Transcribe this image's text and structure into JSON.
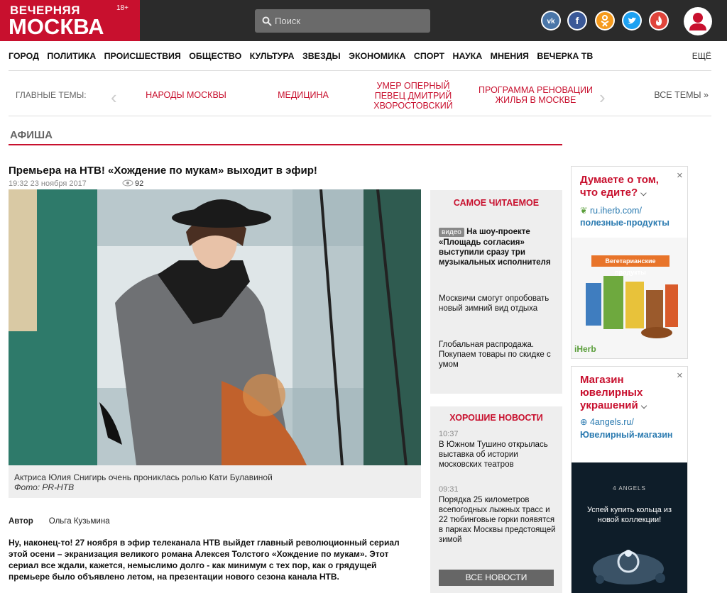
{
  "header": {
    "logo_line1": "ВЕЧЕРНЯЯ",
    "logo_line2": "МОСКВА",
    "age_rating": "18+",
    "search_placeholder": "Поиск"
  },
  "nav": {
    "items": [
      "ГОРОД",
      "ПОЛИТИКА",
      "ПРОИСШЕСТВИЯ",
      "ОБЩЕСТВО",
      "КУЛЬТУРА",
      "ЗВЕЗДЫ",
      "ЭКОНОМИКА",
      "СПОРТ",
      "НАУКА",
      "МНЕНИЯ",
      "ВЕЧЕРКА ТВ"
    ],
    "more": "ЕЩЁ"
  },
  "topics": {
    "label": "ГЛАВНЫЕ ТЕМЫ:",
    "items": [
      "НАРОДЫ МОСКВЫ",
      "МЕДИЦИНА",
      "УМЕР ОПЕРНЫЙ ПЕВЕЦ ДМИТРИЙ ХВОРОСТОВСКИЙ",
      "ПРОГРАММА РЕНОВАЦИИ ЖИЛЬЯ В МОСКВЕ"
    ],
    "all": "ВСЕ ТЕМЫ »"
  },
  "section": "АФИША",
  "article": {
    "title": "Премьера на НТВ! «Хождение по мукам» выходит в эфир!",
    "date": "19:32 23 ноября 2017",
    "views": "92",
    "caption": "Актриса Юлия Снигирь очень прониклась ролью Кати Булавиной",
    "photo_credit": "Фото: PR-НТВ",
    "author_label": "Автор",
    "author_name": "Ольга Кузьмина",
    "lead": "Ну, наконец-то! 27 ноября в эфир телеканала НТВ выйдет главный революционный сериал этой осени – экранизация великого романа Алексея Толстого «Хождение по мукам». Этот сериал все ждали, кажется, немыслимо долго - как минимум с тех пор, как о грядущей премьере было объявлено летом, на презентации нового сезона канала НТВ."
  },
  "most_read": {
    "title": "САМОЕ ЧИТАЕМОЕ",
    "badge": "видео",
    "items": [
      "На шоу-проекте «Площадь согласия» выступили сразу три музыкальных исполнителя",
      "Москвичи смогут опробовать новый зимний вид отдыха",
      "Глобальная распродажа. Покупаем товары по скидке с умом"
    ]
  },
  "good_news": {
    "title": "ХОРОШИЕ НОВОСТИ",
    "items": [
      {
        "time": "10:37",
        "text": "В Южном Тушино открылась выставка об истории московских театров"
      },
      {
        "time": "09:31",
        "text": "Порядка 25 километров всепогодных лыжных трасс и 22 тюбинговые горки появятся в парках Москвы предстоящей зимой"
      }
    ],
    "button": "ВСЕ НОВОСТИ"
  },
  "ads": [
    {
      "headline": "Думаете о том, что едите?",
      "domain": "ru.iherb.com/",
      "url2": "полезные-продукты",
      "banner": "Вегетарианские продукты",
      "brand": "iHerb"
    },
    {
      "headline": "Магазин ювелирных украшений",
      "domain": "4angels.ru/",
      "url2": "Ювелирный-магазин",
      "banner": "Успей купить кольца из новой коллекции!",
      "brand": "4 ANGELS"
    }
  ]
}
